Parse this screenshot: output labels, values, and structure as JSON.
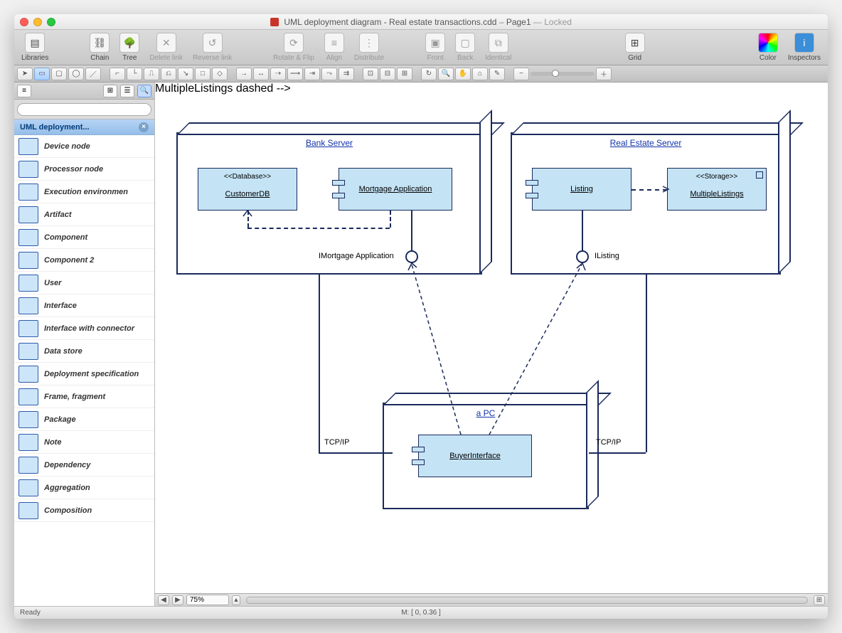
{
  "title": {
    "filename": "UML deployment diagram - Real estate transactions.cdd",
    "page": "Page1",
    "status": "Locked"
  },
  "toolbar": {
    "left": [
      "Libraries"
    ],
    "mid1": [
      "Chain",
      "Tree",
      "Delete link",
      "Reverse link"
    ],
    "mid2": [
      "Rotate & Flip",
      "Align",
      "Distribute"
    ],
    "mid3": [
      "Front",
      "Back",
      "Identical"
    ],
    "grid": "Grid",
    "right": [
      "Color",
      "Inspectors"
    ]
  },
  "sidebar": {
    "header": "UML deployment...",
    "search_placeholder": "",
    "items": [
      "Device node",
      "Processor node",
      "Execution environmen",
      "Artifact",
      "Component",
      "Component 2",
      "User",
      "Interface",
      "Interface with connector",
      "Data store",
      "Deployment specification",
      "Frame, fragment",
      "Package",
      "Note",
      "Dependency",
      "Aggregation",
      "Composition"
    ]
  },
  "diagram": {
    "bank": {
      "title": "Bank Server",
      "db_stereo": "<<Database>>",
      "db_name": "CustomerDB",
      "app_name": "Mortgage Application",
      "iface": "IMortgage Application"
    },
    "estate": {
      "title": "Real Estate Server",
      "listing": "Listing",
      "storage_stereo": "<<Storage>>",
      "storage_name": "MultipleListings",
      "iface": "IListing"
    },
    "pc": {
      "title": "a PC",
      "comp": "BuyerInterface"
    },
    "proto": "TCP/IP"
  },
  "footer": {
    "zoom": "75%",
    "ready": "Ready",
    "mouse": "M: [ 0, 0.36 ]"
  }
}
